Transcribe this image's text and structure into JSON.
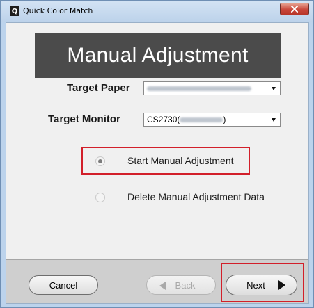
{
  "window": {
    "title": "Quick Color Match",
    "app_icon_letter": "Q",
    "close_icon": "close-icon"
  },
  "header": {
    "title": "Manual Adjustment"
  },
  "fields": {
    "target_paper": {
      "label": "Target Paper",
      "value": ""
    },
    "target_monitor": {
      "label": "Target Monitor",
      "value_prefix": "CS2730(",
      "value_suffix": ")"
    }
  },
  "options": {
    "selected": "start_manual_adjustment",
    "start_manual_adjustment": {
      "label": "Start Manual Adjustment"
    },
    "delete_manual_adjustment_data": {
      "label": "Delete Manual Adjustment Data"
    }
  },
  "footer": {
    "cancel_label": "Cancel",
    "back_label": "Back",
    "next_label": "Next"
  },
  "colors": {
    "highlight": "#d21f2a",
    "banner": "#4b4b4b",
    "window_frame": "#bcd3ec"
  }
}
